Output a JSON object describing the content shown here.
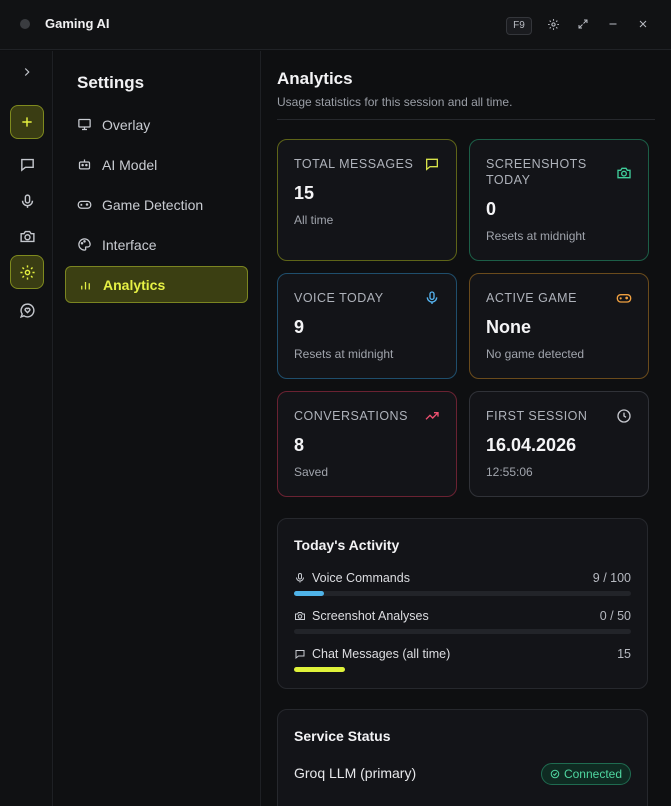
{
  "window": {
    "title": "Gaming AI",
    "hotkey": "F9",
    "controls": [
      "gear-icon",
      "expand-icon",
      "minimize-icon",
      "close-icon"
    ]
  },
  "rail": {
    "items": [
      "chevron-right-icon",
      "plus-icon",
      "chat-icon",
      "mic-icon",
      "camera-icon",
      "gear-icon",
      "heart-chat-icon"
    ]
  },
  "settings_nav": {
    "title": "Settings",
    "items": [
      {
        "label": "Overlay",
        "icon": "monitor-icon"
      },
      {
        "label": "AI Model",
        "icon": "robot-icon"
      },
      {
        "label": "Game Detection",
        "icon": "gamepad-icon"
      },
      {
        "label": "Interface",
        "icon": "palette-icon"
      },
      {
        "label": "Analytics",
        "icon": "bar-chart-icon",
        "active": true
      }
    ]
  },
  "analytics": {
    "title": "Analytics",
    "subtitle": "Usage statistics for this session and all time.",
    "cards": [
      {
        "label": "TOTAL MESSAGES",
        "value": "15",
        "note": "All time",
        "icon": "message-icon",
        "color": "#d7e24a",
        "border": "#5e6418"
      },
      {
        "label": "SCREENSHOTS TODAY",
        "value": "0",
        "note": "Resets at midnight",
        "icon": "camera-icon",
        "color": "#3fcf9b",
        "border": "#1c5e47"
      },
      {
        "label": "VOICE TODAY",
        "value": "9",
        "note": "Resets at midnight",
        "icon": "mic-icon",
        "color": "#56b4f0",
        "border": "#1f4e6c"
      },
      {
        "label": "ACTIVE GAME",
        "value": "None",
        "note": "No game detected",
        "icon": "gamepad-icon",
        "color": "#f0a040",
        "border": "#6a4b1c"
      },
      {
        "label": "CONVERSATIONS",
        "value": "8",
        "note": "Saved",
        "icon": "trending-icon",
        "color": "#ef5070",
        "border": "#6a2232"
      },
      {
        "label": "FIRST SESSION",
        "value": "16.04.2026",
        "note": "12:55:06",
        "icon": "clock-icon",
        "color": "#c6c8ce",
        "border": "#303238"
      }
    ],
    "activity": {
      "title": "Today's Activity",
      "rows": [
        {
          "label": "Voice Commands",
          "value": "9 / 100",
          "fraction": 0.09,
          "color": "#4fb3e8",
          "icon": "mic-icon"
        },
        {
          "label": "Screenshot Analyses",
          "value": "0 / 50",
          "fraction": 0.0,
          "color": "#3fcf9b",
          "icon": "camera-icon"
        },
        {
          "label": "Chat Messages (all time)",
          "value": "15",
          "fraction": 0.15,
          "color": "#dff23a",
          "icon": "message-icon"
        }
      ]
    },
    "service": {
      "title": "Service Status",
      "name": "Groq LLM (primary)",
      "status": "Connected"
    }
  }
}
